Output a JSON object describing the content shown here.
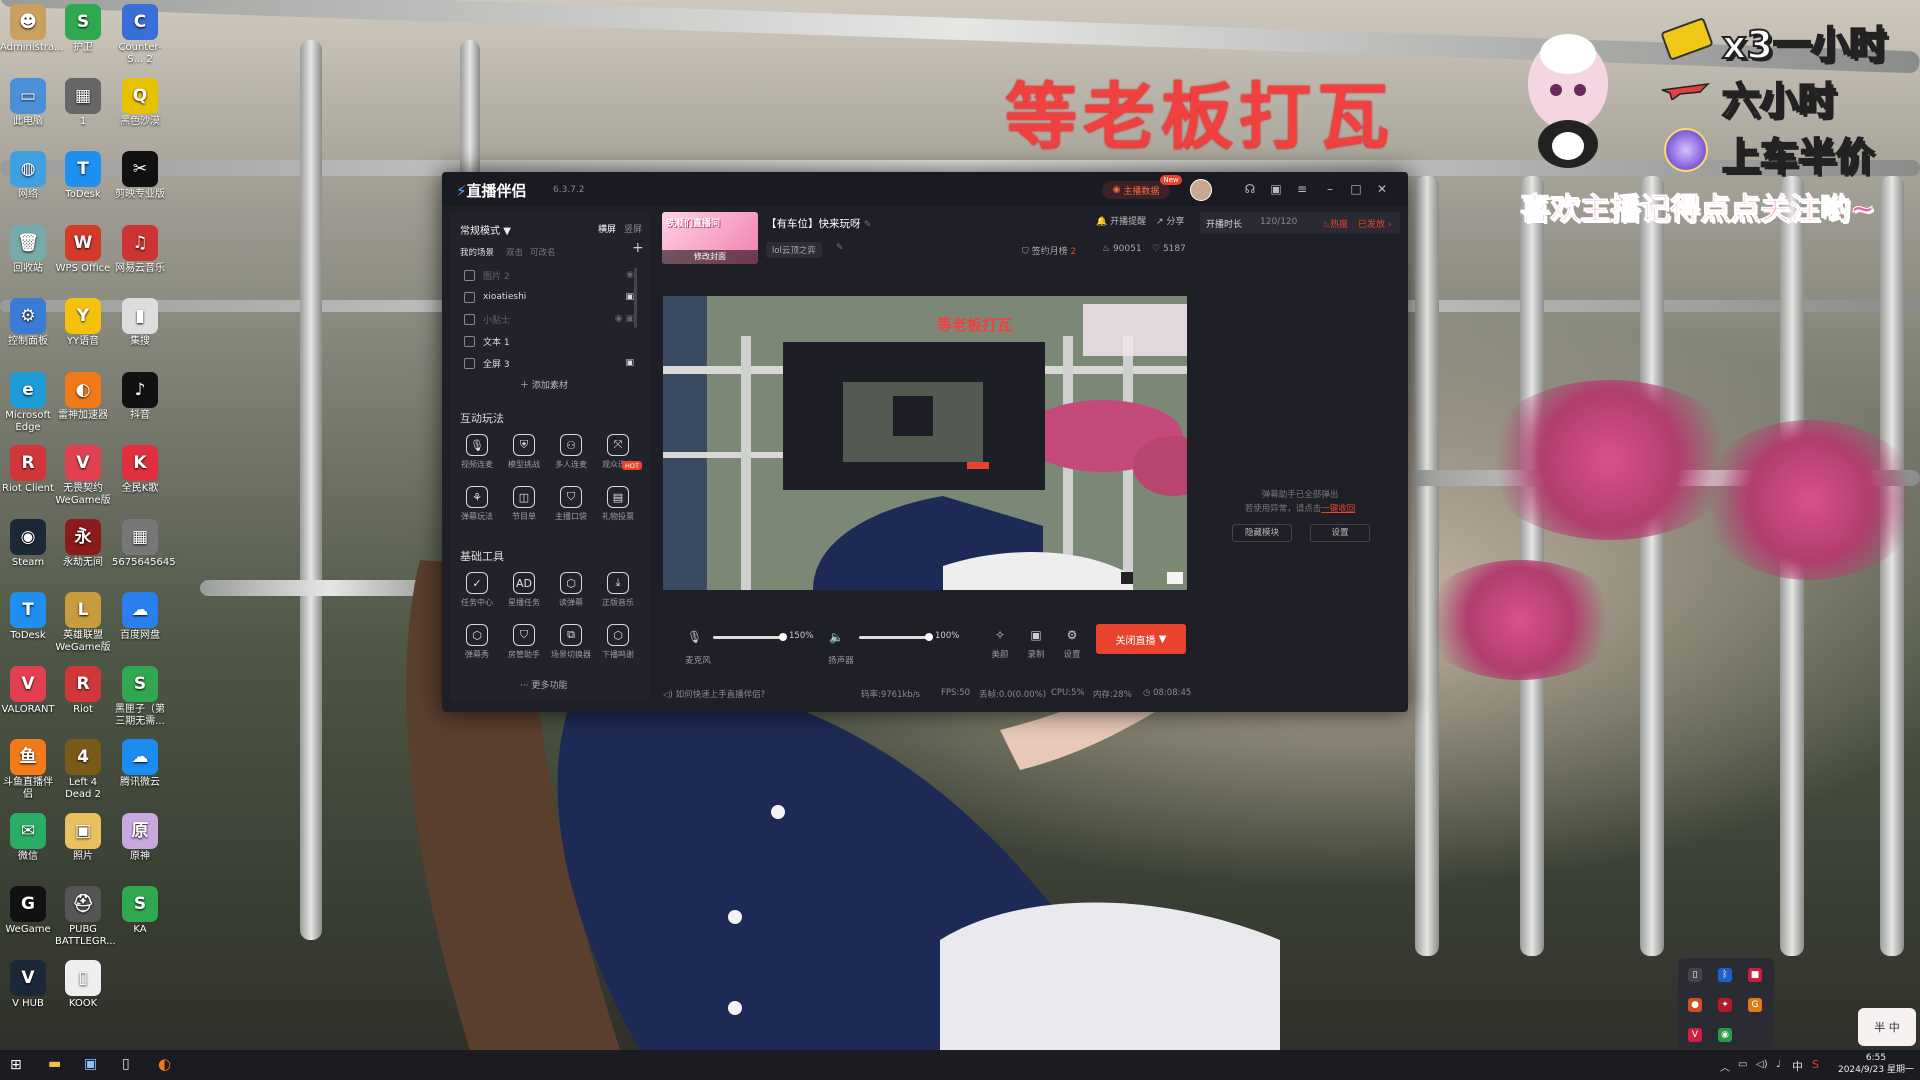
{
  "desktop_icons": [
    {
      "label": "Administra...",
      "glyph": "☻",
      "color": "#caa060"
    },
    {
      "label": "护卫",
      "glyph": "S",
      "color": "#2fa84f"
    },
    {
      "label": "Counter-S... 2",
      "glyph": "C",
      "color": "#3a6fd8"
    },
    {
      "label": "此电脑",
      "glyph": "▭",
      "color": "#4a90d9"
    },
    {
      "label": "1",
      "glyph": "▦",
      "color": "#666"
    },
    {
      "label": "黑色沙漠",
      "glyph": "Q",
      "color": "#e6c200"
    },
    {
      "label": "网络",
      "glyph": "◍",
      "color": "#3fa0e0"
    },
    {
      "label": "ToDesk",
      "glyph": "T",
      "color": "#1f8ff0"
    },
    {
      "label": "剪映专业版",
      "glyph": "✂",
      "color": "#111"
    },
    {
      "label": "回收站",
      "glyph": "🗑",
      "color": "#7aa"
    },
    {
      "label": "WPS Office",
      "glyph": "W",
      "color": "#d23a2a"
    },
    {
      "label": "网易云音乐",
      "glyph": "♫",
      "color": "#cc3333"
    },
    {
      "label": "控制面板",
      "glyph": "⚙",
      "color": "#3a7bd5"
    },
    {
      "label": "YY语音",
      "glyph": "Y",
      "color": "#f4c20d"
    },
    {
      "label": "集搜",
      "glyph": "▮",
      "color": "#ddd"
    },
    {
      "label": "Microsoft Edge",
      "glyph": "e",
      "color": "#1c9bd6"
    },
    {
      "label": "雷神加速器",
      "glyph": "◐",
      "color": "#f07a1a"
    },
    {
      "label": "抖音",
      "glyph": "♪",
      "color": "#111"
    },
    {
      "label": "Riot Client",
      "glyph": "R",
      "color": "#d13639"
    },
    {
      "label": "无畏契约 WeGame版",
      "glyph": "V",
      "color": "#e04050"
    },
    {
      "label": "全民K歌",
      "glyph": "K",
      "color": "#e03040"
    },
    {
      "label": "Steam",
      "glyph": "◉",
      "color": "#1b2838"
    },
    {
      "label": "永劫无间",
      "glyph": "永",
      "color": "#8b1a1a"
    },
    {
      "label": "5675645645",
      "glyph": "▦",
      "color": "#777"
    },
    {
      "label": "ToDesk",
      "glyph": "T",
      "color": "#1f8ff0"
    },
    {
      "label": "英雄联盟 WeGame版",
      "glyph": "L",
      "color": "#c89b3c"
    },
    {
      "label": "百度网盘",
      "glyph": "☁",
      "color": "#2a7ff0"
    },
    {
      "label": "VALORANT",
      "glyph": "V",
      "color": "#e04050"
    },
    {
      "label": "Riot",
      "glyph": "R",
      "color": "#d13639"
    },
    {
      "label": "黑匣子（第三期无需...",
      "glyph": "S",
      "color": "#2fa84f"
    },
    {
      "label": "斗鱼直播伴侣",
      "glyph": "鱼",
      "color": "#f27a1a"
    },
    {
      "label": "Left 4 Dead 2",
      "glyph": "4",
      "color": "#7a5a1a"
    },
    {
      "label": "腾讯微云",
      "glyph": "☁",
      "color": "#1d8cf0"
    },
    {
      "label": "微信",
      "glyph": "✉",
      "color": "#2aae67"
    },
    {
      "label": "照片",
      "glyph": "▣",
      "color": "#e8c060"
    },
    {
      "label": "原神",
      "glyph": "原",
      "color": "#c9a8e0"
    },
    {
      "label": "WeGame",
      "glyph": "G",
      "color": "#111"
    },
    {
      "label": "PUBG BATTLEGR...",
      "glyph": "⛑",
      "color": "#555"
    },
    {
      "label": "KA",
      "glyph": "S",
      "color": "#2fa84f"
    },
    {
      "label": "V HUB",
      "glyph": "V",
      "color": "#1b2838"
    },
    {
      "label": "KOOK",
      "glyph": "▯",
      "color": "#eee"
    }
  ],
  "overlay": {
    "title": "等老板打瓦",
    "lines": [
      "x3一小时",
      "六小时",
      "上车半价"
    ],
    "pink": "喜欢主播记得点点关注哟~"
  },
  "app": {
    "name": "直播伴侣",
    "version": "6.3.7.2",
    "host_data_btn": "主播数据",
    "new_badge": "New",
    "mode_label": "常规模式",
    "orient_tabs": [
      "横屏",
      "竖屏"
    ],
    "scene_tabs": [
      "我的场景",
      "双击",
      "可改名"
    ],
    "scenes": [
      "图片 2",
      "xioatieshi",
      "小贴士",
      "文本 1",
      "全屏 3"
    ],
    "add_material": "添加素材",
    "interactive_heading": "互动玩法",
    "interactive_tools": [
      {
        "label": "视频连麦",
        "glyph": "🎙"
      },
      {
        "label": "模型挑战",
        "glyph": "⛨"
      },
      {
        "label": "多人连麦",
        "glyph": "⚇"
      },
      {
        "label": "观众连麦",
        "glyph": "⤧"
      },
      {
        "label": "弹幕玩法",
        "glyph": "⚘"
      },
      {
        "label": "节目单",
        "glyph": "◫"
      },
      {
        "label": "主播口袋",
        "glyph": "⛉"
      },
      {
        "label": "礼物投票",
        "glyph": "▤"
      }
    ],
    "hot_badge": "HOT",
    "basic_heading": "基础工具",
    "basic_tools": [
      {
        "label": "任务中心",
        "glyph": "✓"
      },
      {
        "label": "星播任务",
        "glyph": "AD"
      },
      {
        "label": "读弹幕",
        "glyph": "⬡"
      },
      {
        "label": "正版音乐",
        "glyph": "⤓"
      },
      {
        "label": "弹幕秀",
        "glyph": "⬡"
      },
      {
        "label": "房管助手",
        "glyph": "⛉"
      },
      {
        "label": "场景切换器",
        "glyph": "⧉"
      },
      {
        "label": "下播鸣谢",
        "glyph": "⬡"
      }
    ],
    "more_features": "更多功能",
    "cover_title": "铁顺们直播间",
    "cover_edit": "修改封面",
    "stream_title": "【有车位】快来玩呀",
    "category": "lol云顶之弈",
    "remind": "开播提醒",
    "share": "分享",
    "stats": {
      "signed_label": "签约月榜",
      "signed_value": "2",
      "fans": "90051",
      "likes": "5187"
    },
    "live_time_label": "开播时长",
    "live_time_value": "120/120",
    "heat_label": "热度",
    "heat_status": "已发放",
    "mic_percent": "150%",
    "speaker_percent": "100%",
    "controls": [
      "麦克风",
      "扬声器",
      "美颜",
      "录制",
      "设置"
    ],
    "stop_button": "关闭直播",
    "danmaku_msg1": "弹幕助手已全部弹出",
    "danmaku_msg2": "若使用异常，请点击",
    "danmaku_link": "一键收回",
    "hide_panel": "隐藏模块",
    "settings_btn": "设置",
    "help_text": "如何快速上手直播伴侣?",
    "status": {
      "bitrate": "码率:9761kb/s",
      "fps": "FPS:50",
      "drop": "丢帧:0.0(0.00%)",
      "cpu": "CPU:5%",
      "mem": "内存:28%",
      "time": "08:08:45"
    },
    "preview_overlay": "等老板打瓦"
  },
  "taskbar": {
    "time": "6:55",
    "date": "2024/9/23 星期一",
    "ime": "中",
    "ime_float": "半 中"
  },
  "colors": {
    "accent": "#f25022",
    "live_red": "#e8432d",
    "overlay_red": "#f04040",
    "pink": "#ff5aa5"
  }
}
